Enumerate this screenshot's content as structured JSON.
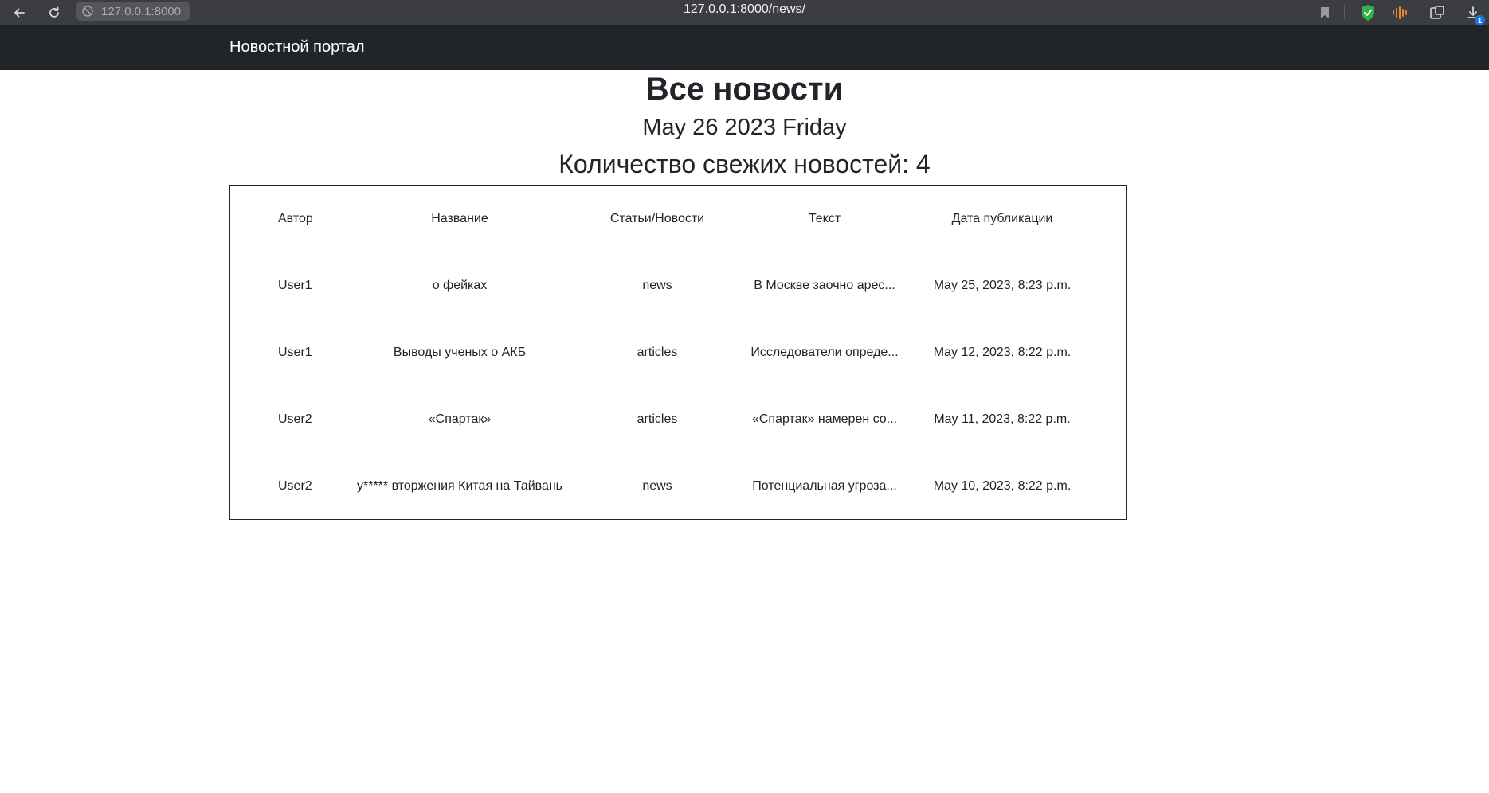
{
  "browser": {
    "site_chip": "127.0.0.1:8000",
    "url": "127.0.0.1:8000/news/",
    "downloads_badge": "1",
    "icons": [
      "back-arrow-icon",
      "reload-icon",
      "site-info-icon",
      "bookmark-icon",
      "shield-check-icon",
      "audio-wave-icon",
      "extensions-icon",
      "download-icon"
    ]
  },
  "navbar": {
    "brand": "Новостной портал"
  },
  "page": {
    "title": "Все новости",
    "date": "May 26 2023 Friday",
    "count": "Количество свежих новостей: 4"
  },
  "table": {
    "headers": [
      "Автор",
      "Название",
      "Статьи/Новости",
      "Текст",
      "Дата публикации"
    ],
    "rows": [
      [
        "User1",
        "о фейках",
        "news",
        "В Москве заочно арес...",
        "May 25, 2023, 8:23 p.m."
      ],
      [
        "User1",
        "Выводы ученых о АКБ",
        "articles",
        "Исследователи опреде...",
        "May 12, 2023, 8:22 p.m."
      ],
      [
        "User2",
        "«Спартак»",
        "articles",
        "«Спартак» намерен со...",
        "May 11, 2023, 8:22 p.m."
      ],
      [
        "User2",
        "у***** вторжения Китая на Тайвань",
        "news",
        "Потенциальная угроза...",
        "May 10, 2023, 8:22 p.m."
      ]
    ]
  },
  "colors": {
    "browser_bar": "#3c3c43",
    "navbar": "#212529",
    "shield": "#2fb344",
    "audio": "#e8892c",
    "badge": "#1a73e8"
  }
}
